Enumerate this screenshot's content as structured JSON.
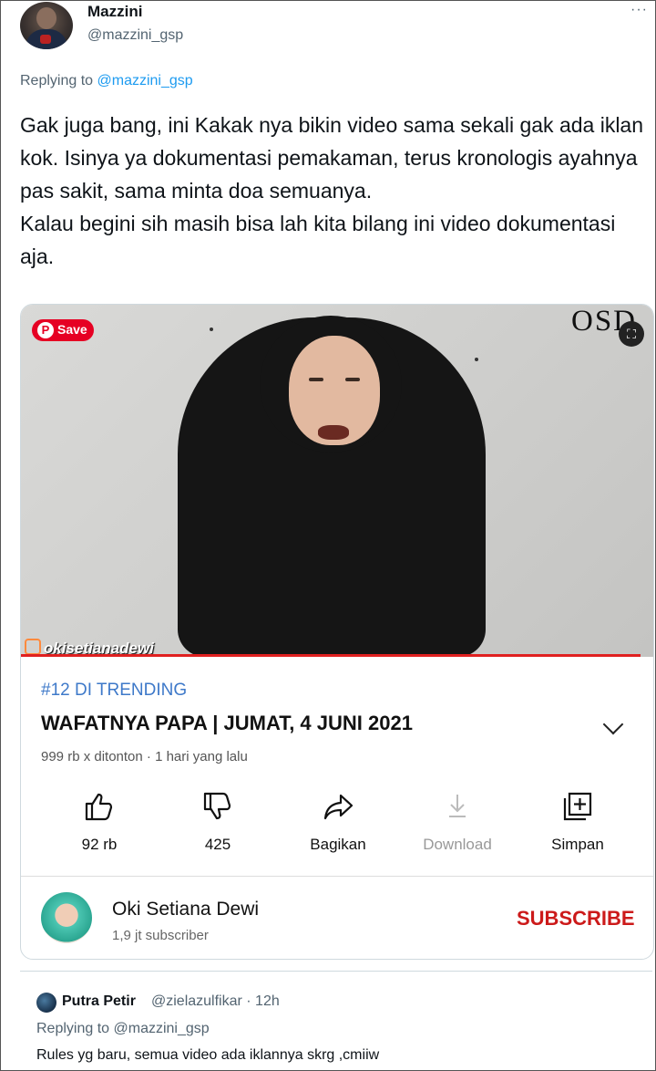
{
  "tweet": {
    "author_name": "Mazzini",
    "author_handle": "@mazzini_gsp",
    "more_label": "···",
    "replying_prefix": "Replying to ",
    "replying_handle": "@mazzini_gsp",
    "text": "Gak juga bang, ini Kakak nya bikin video sama sekali gak ada iklan kok. Isinya ya dokumentasi pemakaman, terus kronologis ayahnya pas sakit, sama minta doa semuanya.\nKalau begini sih masih bisa lah kita bilang ini video dokumentasi aja."
  },
  "video": {
    "pinterest_save": "Save",
    "watermark": "OSD",
    "instagram_tag": "okisetianadewi",
    "trending": "#12 DI TRENDING",
    "title": "WAFATNYA PAPA | JUMAT, 4 JUNI 2021",
    "views": "999 rb x ditonton · 1 hari yang lalu",
    "progress_fraction": 0.98,
    "actions": [
      {
        "icon": "thumbs-up-icon",
        "label": "92 rb"
      },
      {
        "icon": "thumbs-down-icon",
        "label": "425"
      },
      {
        "icon": "share-icon",
        "label": "Bagikan"
      },
      {
        "icon": "download-icon",
        "label": "Download"
      },
      {
        "icon": "save-to-playlist-icon",
        "label": "Simpan"
      }
    ],
    "channel_name": "Oki Setiana Dewi",
    "channel_subs": "1,9 jt subscriber",
    "subscribe": "SUBSCRIBE"
  },
  "reply": {
    "author_name": "Putra Petir",
    "author_handle": "@zielazulfikar · 12h",
    "replying": "Replying to @mazzini_gsp",
    "text": "Rules yg baru, semua video ada iklannya  skrg ,cmiiw"
  },
  "colors": {
    "link": "#1d9bf0",
    "trending": "#3e79c9",
    "subscribe": "#cc1a1a",
    "progress": "#e02020"
  }
}
